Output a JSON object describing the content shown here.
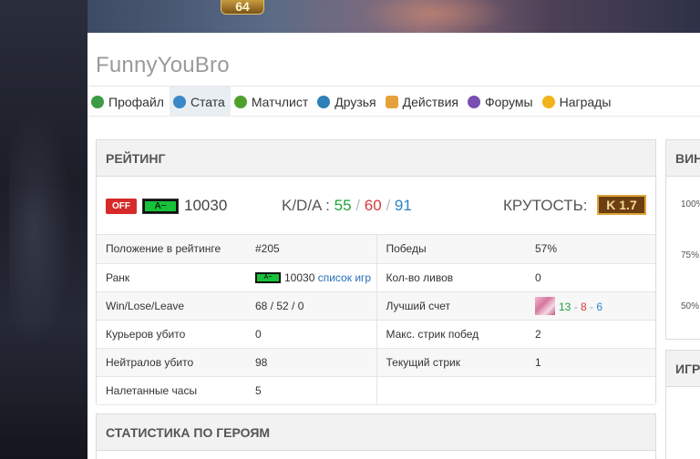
{
  "banner": {
    "level": "64"
  },
  "site": {
    "title": "FunnyYouBro"
  },
  "tabs": [
    {
      "label": "Профайл",
      "icon": "profile-icon"
    },
    {
      "label": "Стата",
      "icon": "stats-icon"
    },
    {
      "label": "Матчлист",
      "icon": "matchlist-icon"
    },
    {
      "label": "Друзья",
      "icon": "friends-icon"
    },
    {
      "label": "Действия",
      "icon": "actions-icon"
    },
    {
      "label": "Форумы",
      "icon": "forums-icon"
    },
    {
      "label": "Награды",
      "icon": "awards-icon"
    }
  ],
  "rating": {
    "title": "РЕЙТИНГ",
    "off_label": "OFF",
    "rank_badge": "A−",
    "mmr": "10030",
    "kda_label": "K/D/A :",
    "kda": {
      "k": "55",
      "d": "60",
      "a": "91",
      "sep": "/"
    },
    "coolness_label": "КРУТОСТЬ:",
    "coolness_value": "K 1.7",
    "rows": [
      {
        "l1": "Положение в рейтинге",
        "v1": "#205",
        "l2": "Победы",
        "v2": "57%"
      },
      {
        "l1": "Ранк",
        "v1_rank": "A−",
        "v1_value": "10030",
        "v1_link": "список игр",
        "l2": "Кол-во ливов",
        "v2": "0"
      },
      {
        "l1": "Win/Lose/Leave",
        "v1": "68 / 52 / 0",
        "l2": "Лучший счет",
        "best": {
          "k": "13",
          "d": "8",
          "a": "6"
        }
      },
      {
        "l1": "Курьеров убито",
        "v1": "0",
        "l2": "Макс. стрик побед",
        "v2": "2"
      },
      {
        "l1": "Нейтралов убито",
        "v1": "98",
        "l2": "Текущий стрик",
        "v2": "1"
      },
      {
        "l1": "Налетанные часы",
        "v1": "5",
        "l2": "",
        "v2": ""
      }
    ]
  },
  "heroes": {
    "title": "СТАТИСТИКА ПО ГЕРОЯМ"
  },
  "side": {
    "winrate_title": "ВИН",
    "ticks": [
      "100%",
      "75%",
      "50%"
    ],
    "games_title": "ИГР"
  }
}
